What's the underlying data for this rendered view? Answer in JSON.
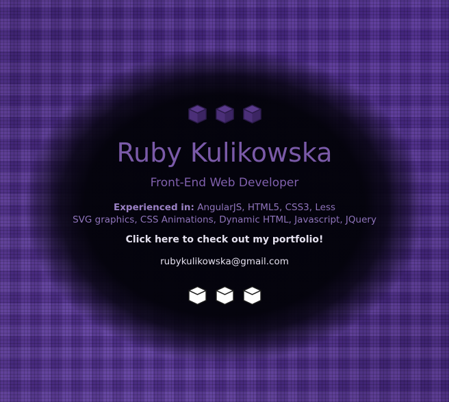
{
  "profile": {
    "name": "Ruby Kulikowska",
    "role": "Front-End Web Developer",
    "experience_label": "Experienced in:",
    "experience_line1": "AngularJS, HTML5, CSS3, Less",
    "experience_line2": "SVG graphics, CSS Animations, Dynamic HTML, Javascript, JQuery",
    "portfolio_link": "Click here to check out my portfolio!",
    "email": "rubykulikowska@gmail.com"
  },
  "icons": {
    "top": [
      "cube-icon",
      "cube-icon",
      "cube-icon"
    ],
    "bottom": [
      "cube-icon",
      "cube-icon",
      "cube-icon"
    ]
  },
  "colors": {
    "background": "#4a2a86",
    "name_text": "#7a5aa8",
    "top_cubes": "#4b2f78",
    "bottom_cubes": "#ffffff"
  }
}
